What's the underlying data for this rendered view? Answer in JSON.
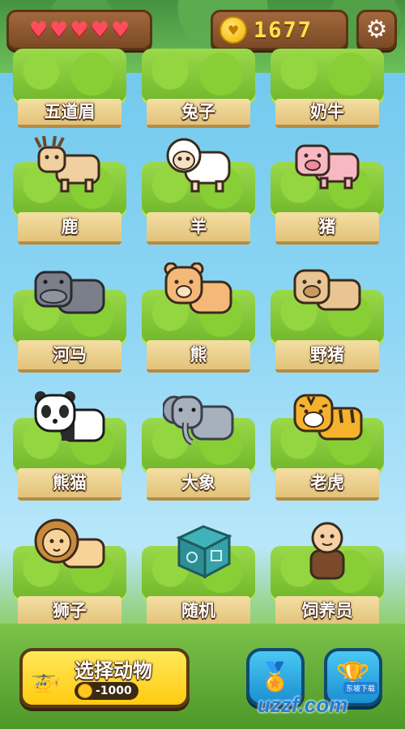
{
  "hud": {
    "lives": 5,
    "coins": "1677"
  },
  "animals": [
    {
      "label": "五道眉"
    },
    {
      "label": "兔子"
    },
    {
      "label": "奶牛"
    },
    {
      "label": "鹿"
    },
    {
      "label": "羊"
    },
    {
      "label": "猪"
    },
    {
      "label": "河马"
    },
    {
      "label": "熊"
    },
    {
      "label": "野猪"
    },
    {
      "label": "熊猫"
    },
    {
      "label": "大象"
    },
    {
      "label": "老虎"
    },
    {
      "label": "狮子"
    },
    {
      "label": "随机"
    },
    {
      "label": "饲养员"
    }
  ],
  "actions": {
    "select_label": "选择动物",
    "select_cost": "-1000"
  },
  "watermark": {
    "text": "uzzf.com",
    "sub": "东坡下载"
  },
  "colors": {
    "heart": "#ff4d5e",
    "coin": "#ffc820",
    "button_yellow": "#ffd21c",
    "button_blue": "#2aa6e2"
  }
}
